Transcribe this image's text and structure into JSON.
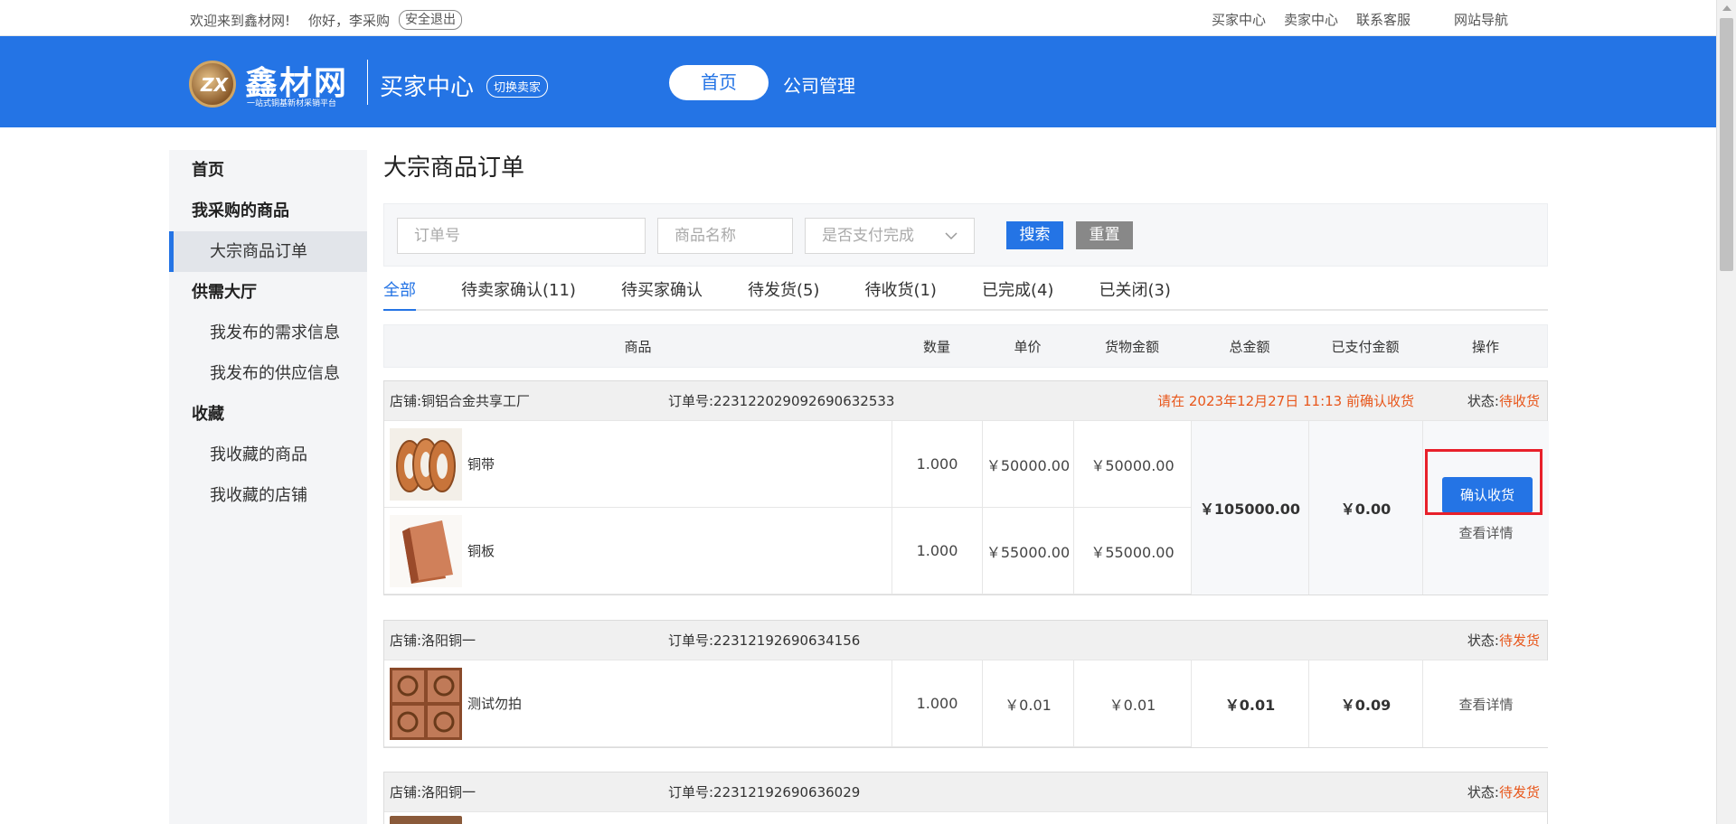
{
  "topbar": {
    "welcome": "欢迎来到鑫材网!",
    "greeting": "你好，李采购",
    "logout": "安全退出",
    "links": [
      "买家中心",
      "卖家中心",
      "联系客服"
    ],
    "site_nav": "网站导航"
  },
  "header": {
    "logo_text": "鑫材网",
    "logo_mark": "ZX",
    "logo_sub": "一站式铜基新材采销平台",
    "center_title": "买家中心",
    "switch_label": "切换卖家",
    "nav_home": "首页",
    "nav_company": "公司管理"
  },
  "sidebar": {
    "home": "首页",
    "group1": "我采购的商品",
    "bulk_orders": "大宗商品订单",
    "group2": "供需大厅",
    "my_demand": "我发布的需求信息",
    "my_supply": "我发布的供应信息",
    "group3": "收藏",
    "fav_goods": "我收藏的商品",
    "fav_shops": "我收藏的店铺"
  },
  "main": {
    "title": "大宗商品订单",
    "filter": {
      "order_placeholder": "订单号",
      "name_placeholder": "商品名称",
      "paid_placeholder": "是否支付完成",
      "search": "搜索",
      "reset": "重置"
    },
    "tabs": [
      "全部",
      "待卖家确认(11)",
      "待买家确认",
      "待发货(5)",
      "待收货(1)",
      "已完成(4)",
      "已关闭(3)"
    ],
    "columns": {
      "goods": "商品",
      "qty": "数量",
      "unit_price": "单价",
      "goods_amount": "货物金额",
      "total": "总金额",
      "paid": "已支付金额",
      "action": "操作"
    },
    "orders": [
      {
        "shop": "店铺:铜铝合金共享工厂",
        "order_no": "订单号:223122029092690632533",
        "notice": "请在 2023年12月27日 11:13 前确认收货",
        "status_label": "状态:",
        "status": "待收货",
        "items": [
          {
            "name": "铜带",
            "qty": "1.000",
            "price": "￥50000.00",
            "amount": "￥50000.00"
          },
          {
            "name": "铜板",
            "qty": "1.000",
            "price": "￥55000.00",
            "amount": "￥55000.00"
          }
        ],
        "total": "￥105000.00",
        "paid": "￥0.00",
        "confirm": "确认收货",
        "detail": "查看详情"
      },
      {
        "shop": "店铺:洛阳铜一",
        "order_no": "订单号:22312192690634156",
        "status_label": "状态:",
        "status": "待发货",
        "items": [
          {
            "name": "测试勿拍",
            "qty": "1.000",
            "price": "￥0.01",
            "amount": "￥0.01"
          }
        ],
        "total": "￥0.01",
        "paid": "￥0.09",
        "detail": "查看详情"
      },
      {
        "shop": "店铺:洛阳铜一",
        "order_no": "订单号:22312192690636029",
        "status_label": "状态:",
        "status": "待发货"
      }
    ]
  },
  "colors": {
    "brand_blue": "#2474e5",
    "status_orange": "#e8561a",
    "highlight_red": "#e8202a"
  }
}
